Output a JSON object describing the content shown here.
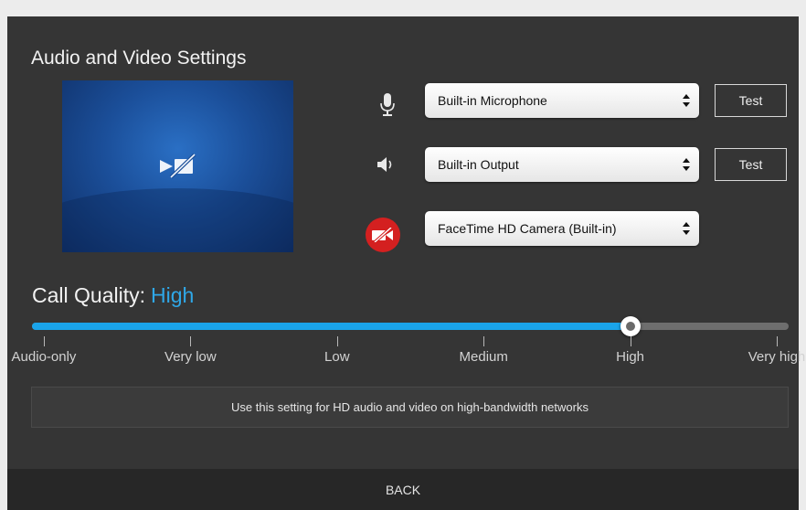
{
  "header": {
    "title": "Audio and Video Settings"
  },
  "devices": {
    "microphone": {
      "icon": "microphone-icon",
      "selected": "Built-in Microphone",
      "test_label": "Test"
    },
    "speaker": {
      "icon": "speaker-icon",
      "selected": "Built-in Output",
      "test_label": "Test"
    },
    "camera": {
      "icon": "camera-off-icon",
      "selected": "FaceTime HD Camera (Built-in)"
    }
  },
  "preview": {
    "icon": "camera-off-icon"
  },
  "quality": {
    "label": "Call Quality:",
    "value": "High",
    "levels": [
      "Audio-only",
      "Very low",
      "Low",
      "Medium",
      "High",
      "Very high"
    ],
    "selected_index": 4,
    "description": "Use this setting for HD audio and video on high-bandwidth networks"
  },
  "footer": {
    "back_label": "BACK"
  },
  "colors": {
    "accent": "#1aa4ea",
    "panel": "#353535",
    "camera_off_badge": "#d42020"
  }
}
